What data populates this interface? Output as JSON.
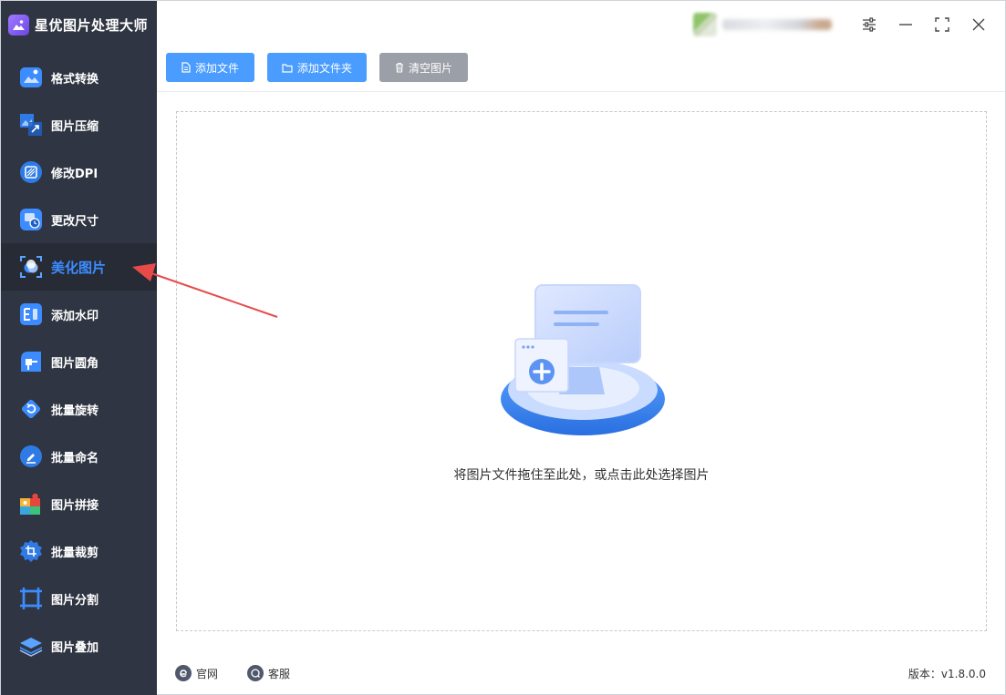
{
  "app": {
    "title": "星优图片处理大师",
    "accent": "#3d8cff",
    "sidebar_bg": "#2f3542"
  },
  "sidebar": {
    "items": [
      {
        "label": "格式转换",
        "icon": "image-convert-icon"
      },
      {
        "label": "图片压缩",
        "icon": "image-compress-icon"
      },
      {
        "label": "修改DPI",
        "icon": "dpi-icon"
      },
      {
        "label": "更改尺寸",
        "icon": "resize-icon"
      },
      {
        "label": "美化图片",
        "icon": "beautify-icon",
        "active": true
      },
      {
        "label": "添加水印",
        "icon": "watermark-icon"
      },
      {
        "label": "图片圆角",
        "icon": "rounded-corner-icon"
      },
      {
        "label": "批量旋转",
        "icon": "rotate-icon"
      },
      {
        "label": "批量命名",
        "icon": "rename-icon"
      },
      {
        "label": "图片拼接",
        "icon": "puzzle-icon"
      },
      {
        "label": "批量裁剪",
        "icon": "crop-icon"
      },
      {
        "label": "图片分割",
        "icon": "split-icon"
      },
      {
        "label": "图片叠加",
        "icon": "layers-icon"
      }
    ]
  },
  "toolbar": {
    "add_file": "添加文件",
    "add_folder": "添加文件夹",
    "clear_images": "清空图片"
  },
  "dropzone": {
    "hint": "将图片文件拖住至此处，或点击此处选择图片"
  },
  "footer": {
    "website": "官网",
    "support": "客服",
    "version": "版本：v1.8.0.0"
  }
}
